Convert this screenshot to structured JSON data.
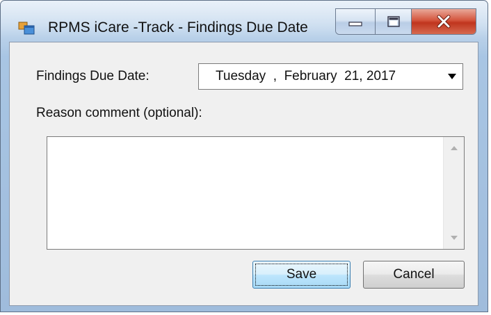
{
  "window": {
    "title": "RPMS iCare -Track - Findings Due Date",
    "controls": [
      "minimize",
      "maximize",
      "close"
    ]
  },
  "form": {
    "due_date_label": "Findings Due Date:",
    "due_date_value": "Tuesday  ,  February  21, 2017",
    "reason_label": "Reason comment (optional):",
    "reason_value": ""
  },
  "buttons": {
    "save_label": "Save",
    "cancel_label": "Cancel"
  },
  "icons": {
    "app": "app-window-icon",
    "minimize": "minimize-icon",
    "maximize": "maximize-icon",
    "close": "close-icon",
    "dropdown": "chevron-down-icon",
    "scroll_up": "scroll-up-arrow-icon",
    "scroll_down": "scroll-down-arrow-icon"
  },
  "colors": {
    "close_button": "#c0351e",
    "window_frame": "#a9c6e4",
    "client_background": "#f0f0f0",
    "default_button_border": "#3c7fb1"
  }
}
